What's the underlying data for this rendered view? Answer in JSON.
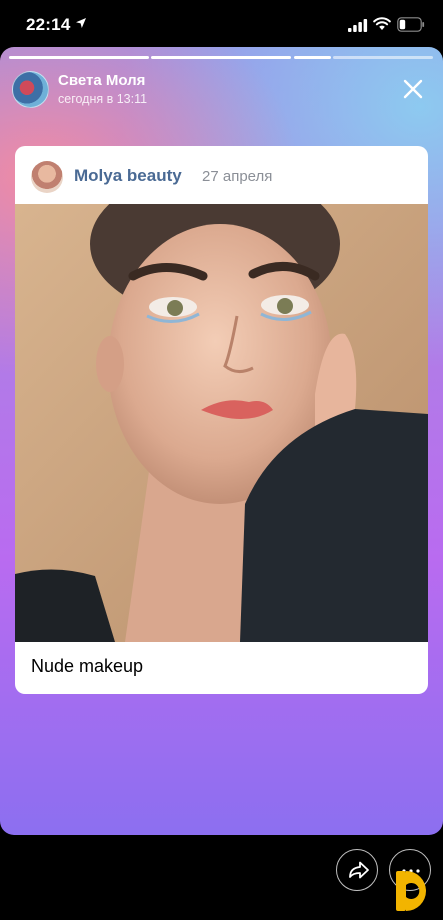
{
  "status_bar": {
    "time": "22:14"
  },
  "story": {
    "author_name": "Света Моля",
    "post_time": "сегодня в 13:11",
    "progress_segments": 4,
    "progress_completed": 2
  },
  "post": {
    "group_name": "Molya beauty",
    "date": "27 апреля",
    "caption": "Nude makeup"
  },
  "icons": {
    "close": "close-icon",
    "share": "share-icon",
    "more": "more-icon",
    "location": "location-arrow-icon",
    "signal": "signal-icon",
    "wifi": "wifi-icon",
    "battery": "battery-icon"
  },
  "colors": {
    "accent": "#4a6a94",
    "date": "#8b8f97"
  }
}
